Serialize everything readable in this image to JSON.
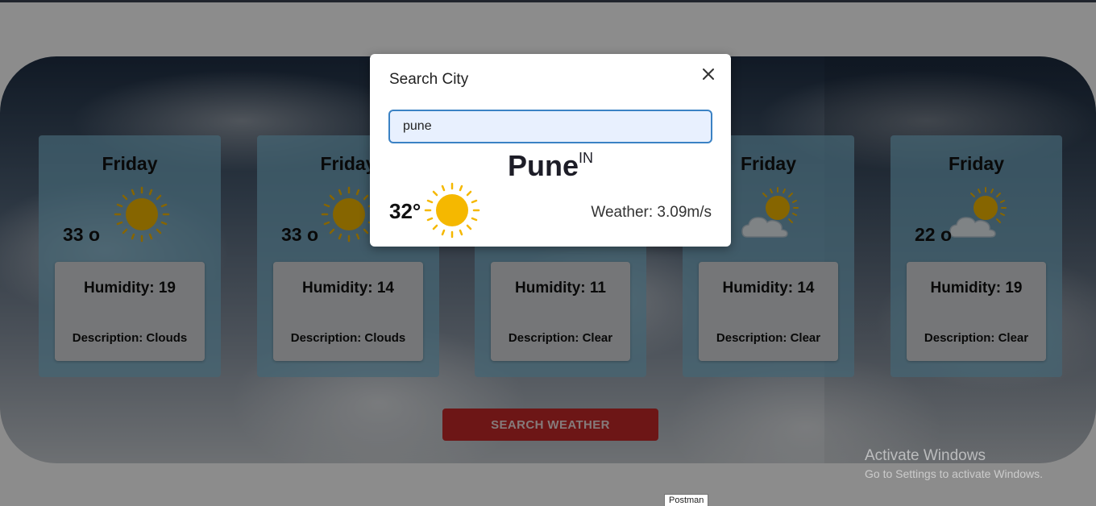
{
  "cards": [
    {
      "day": "Friday",
      "temp": "33 o",
      "icon": "sun-icon",
      "humidity": "Humidity: 19",
      "description": "Description: Clouds"
    },
    {
      "day": "Friday",
      "temp": "33 o",
      "icon": "sun-icon",
      "humidity": "Humidity: 14",
      "description": "Description: Clouds"
    },
    {
      "day": "",
      "temp": "",
      "icon": "",
      "humidity": "Humidity: 11",
      "description": "Description: Clear"
    },
    {
      "day": "Friday",
      "temp": "o",
      "icon": "partly-cloudy-icon",
      "humidity": "Humidity: 14",
      "description": "Description: Clear"
    },
    {
      "day": "Friday",
      "temp": "22 o",
      "icon": "partly-cloudy-icon",
      "humidity": "Humidity: 19",
      "description": "Description: Clear"
    }
  ],
  "search_button_label": "SEARCH WEATHER",
  "modal": {
    "title": "Search City",
    "close_icon": "close-icon",
    "input_value": "pune",
    "city": "Pune",
    "country": "IN",
    "temp": "32°",
    "weather_icon": "sun-icon",
    "wind": "Weather: 3.09m/s"
  },
  "watermark": {
    "title": "Activate Windows",
    "subtitle": "Go to Settings to activate Windows."
  },
  "tooltip": "Postman",
  "colors": {
    "card": "#7db9d2",
    "button": "#c62828",
    "sun": "#f5b800",
    "input_bg": "#e8f0fe",
    "input_border": "#3b82c4"
  }
}
